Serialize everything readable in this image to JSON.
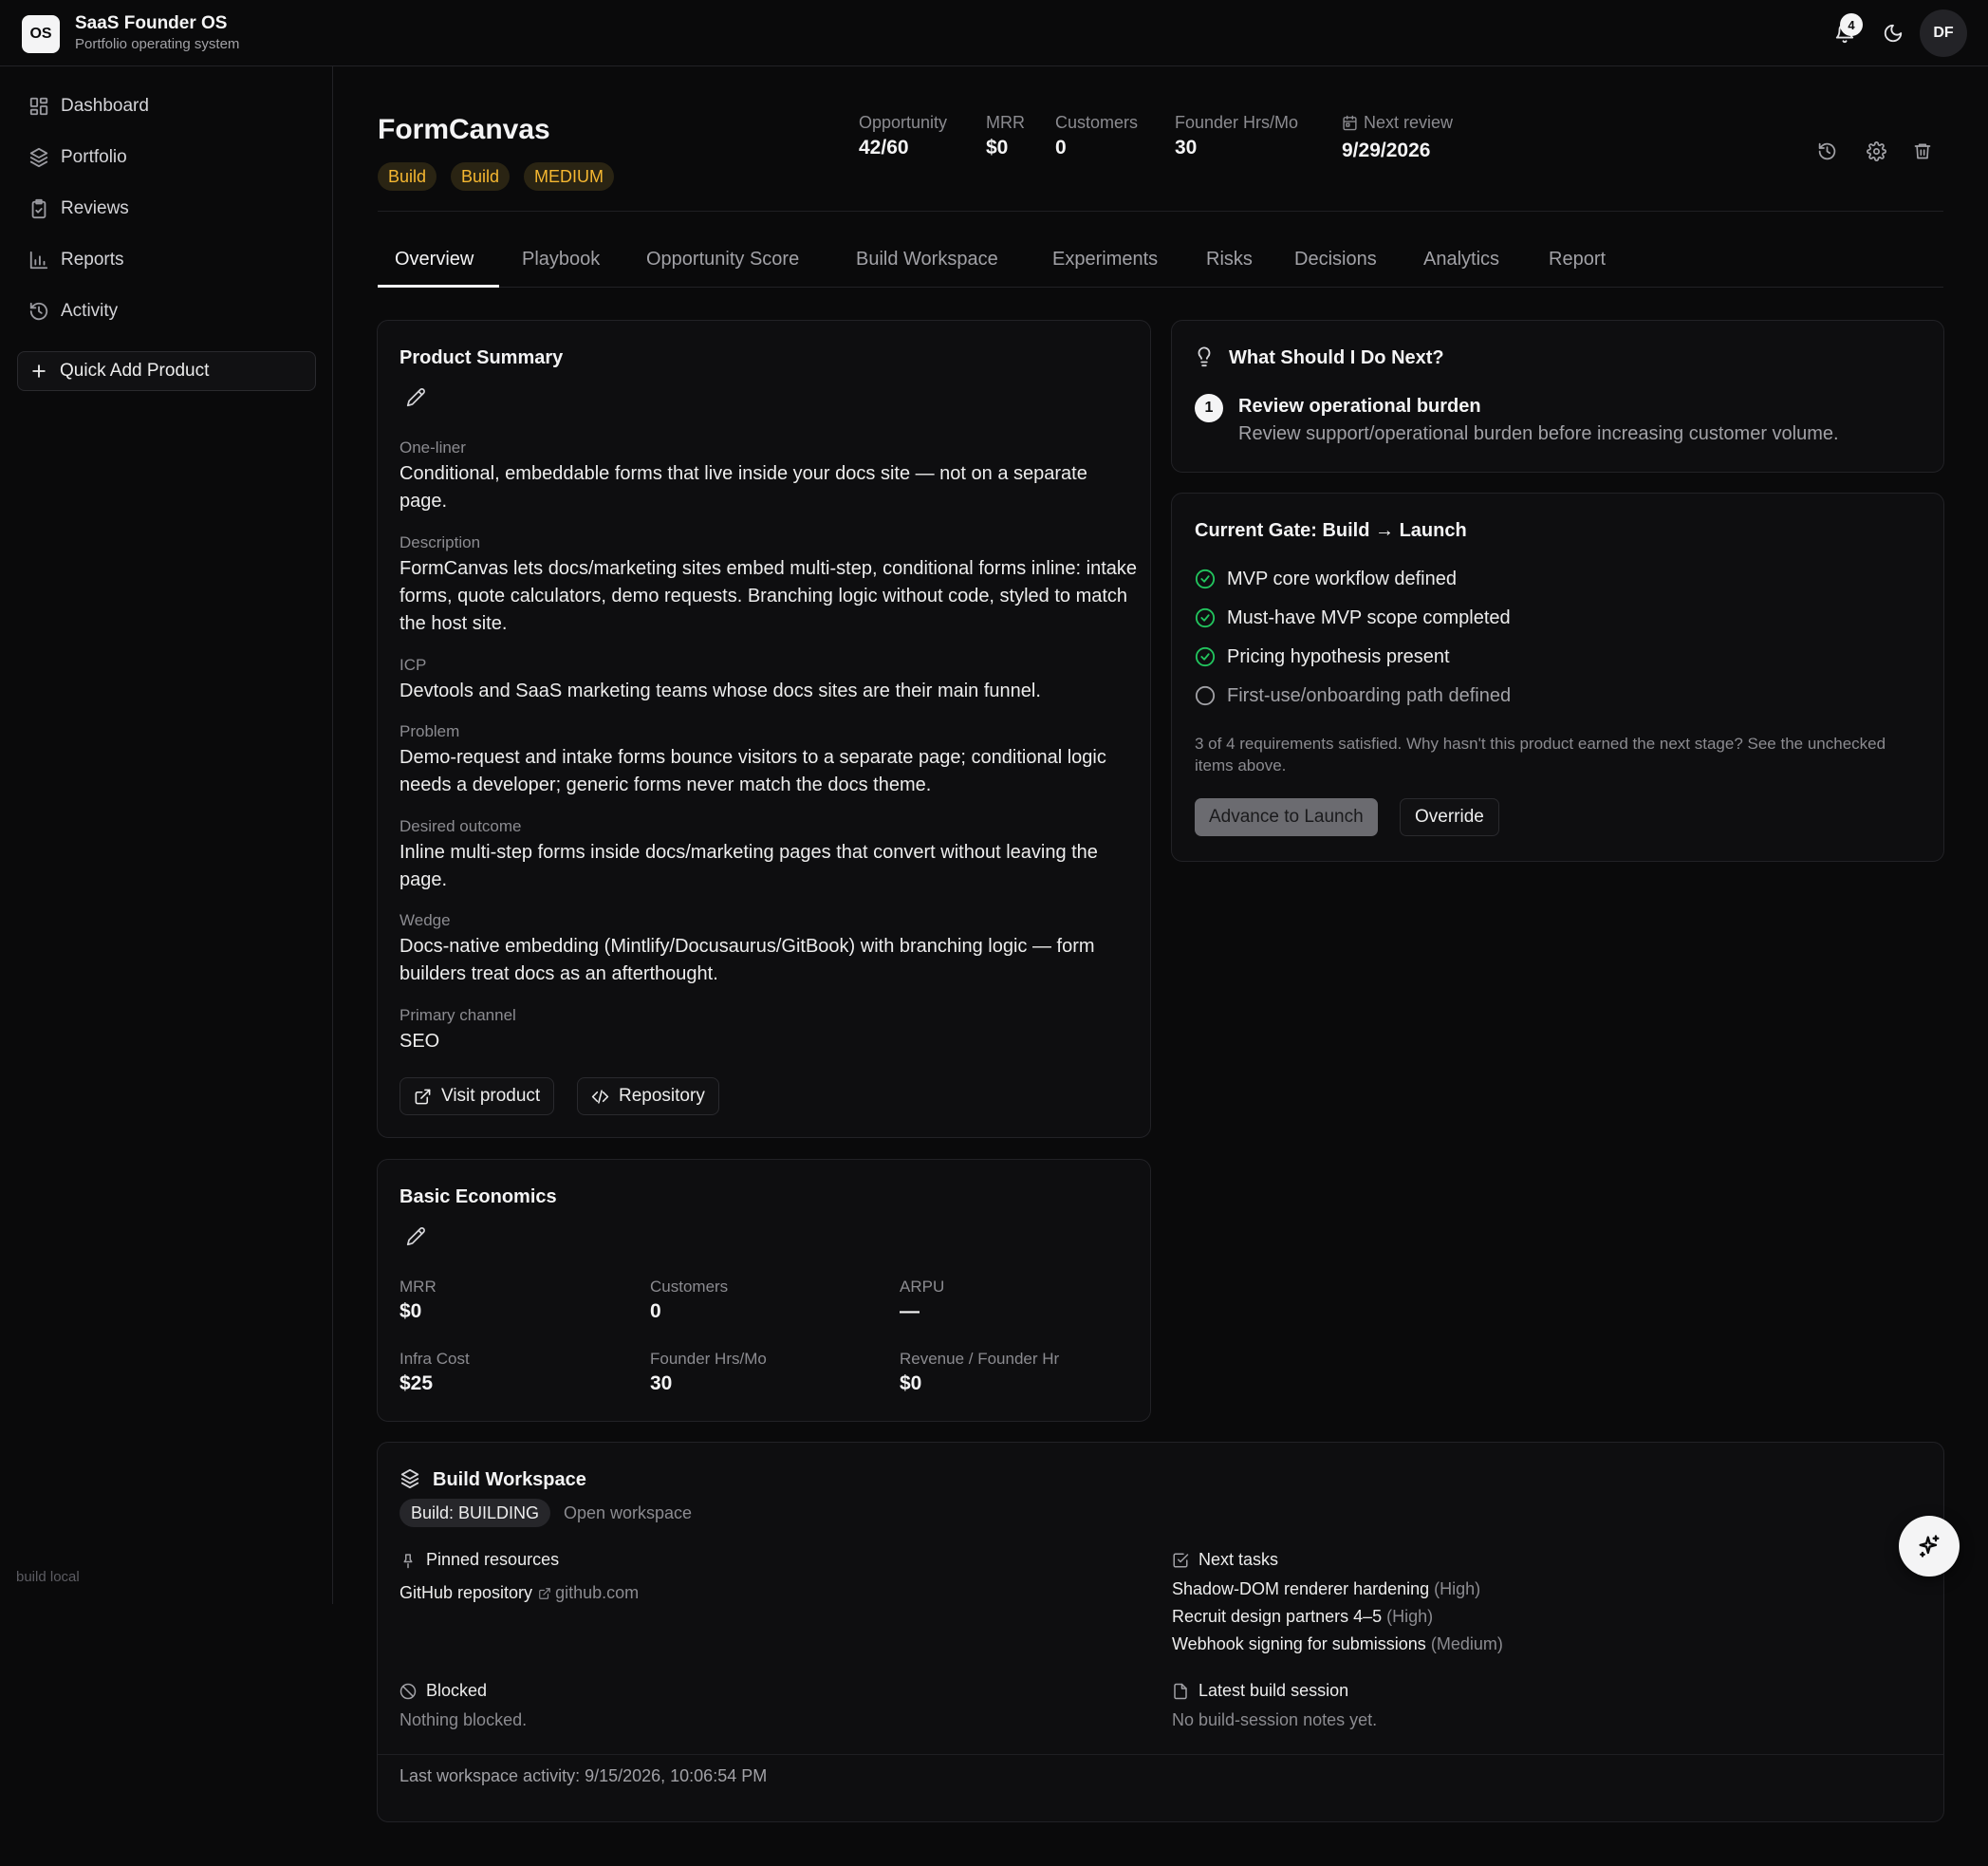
{
  "app": {
    "logo": "OS",
    "title": "SaaS Founder OS",
    "subtitle": "Portfolio operating system",
    "notifications_count": "4",
    "avatar_initials": "DF"
  },
  "sidebar": {
    "items": [
      {
        "label": "Dashboard",
        "icon": "grid-icon"
      },
      {
        "label": "Portfolio",
        "icon": "layers-icon"
      },
      {
        "label": "Reviews",
        "icon": "clipboard-check-icon"
      },
      {
        "label": "Reports",
        "icon": "bar-chart-icon"
      },
      {
        "label": "Activity",
        "icon": "history-icon"
      }
    ],
    "quick_add_label": "Quick Add Product",
    "footer": "build local"
  },
  "product": {
    "name": "FormCanvas",
    "badges": [
      "Build",
      "Build",
      "MEDIUM"
    ],
    "metrics": [
      {
        "label": "Opportunity",
        "value": "42/60"
      },
      {
        "label": "MRR",
        "value": "$0"
      },
      {
        "label": "Customers",
        "value": "0"
      },
      {
        "label": "Founder Hrs/Mo",
        "value": "30"
      },
      {
        "label": "Next review",
        "value": "9/29/2026"
      }
    ]
  },
  "tabs": [
    "Overview",
    "Playbook",
    "Opportunity Score",
    "Build Workspace",
    "Experiments",
    "Risks",
    "Decisions",
    "Analytics",
    "Report"
  ],
  "summary": {
    "title": "Product Summary",
    "fields": [
      {
        "label": "One-liner",
        "value": "Conditional, embeddable forms that live inside your docs site — not on a separate page."
      },
      {
        "label": "Description",
        "value": "FormCanvas lets docs/marketing sites embed multi-step, conditional forms inline: intake forms, quote calculators, demo requests. Branching logic without code, styled to match the host site."
      },
      {
        "label": "ICP",
        "value": "Devtools and SaaS marketing teams whose docs sites are their main funnel."
      },
      {
        "label": "Problem",
        "value": "Demo-request and intake forms bounce visitors to a separate page; conditional logic needs a developer; generic forms never match the docs theme."
      },
      {
        "label": "Desired outcome",
        "value": "Inline multi-step forms inside docs/marketing pages that convert without leaving the page."
      },
      {
        "label": "Wedge",
        "value": "Docs-native embedding (Mintlify/Docusaurus/GitBook) with branching logic — form builders treat docs as an afterthought."
      },
      {
        "label": "Primary channel",
        "value": "SEO"
      }
    ],
    "visit_label": "Visit product",
    "repo_label": "Repository"
  },
  "economics": {
    "title": "Basic Economics",
    "items": [
      {
        "label": "MRR",
        "value": "$0"
      },
      {
        "label": "Customers",
        "value": "0"
      },
      {
        "label": "ARPU",
        "value": "—"
      },
      {
        "label": "Infra Cost",
        "value": "$25"
      },
      {
        "label": "Founder Hrs/Mo",
        "value": "30"
      },
      {
        "label": "Revenue / Founder Hr",
        "value": "$0"
      }
    ]
  },
  "next": {
    "title": "What Should I Do Next?",
    "step_number": "1",
    "step_title": "Review operational burden",
    "step_desc": "Review support/operational burden before increasing customer volume."
  },
  "gate": {
    "title": "Current Gate: Build → Launch",
    "items": [
      {
        "label": "MVP core workflow defined",
        "done": true
      },
      {
        "label": "Must-have MVP scope completed",
        "done": true
      },
      {
        "label": "Pricing hypothesis present",
        "done": true
      },
      {
        "label": "First-use/onboarding path defined",
        "done": false
      }
    ],
    "note": "3 of 4 requirements satisfied. Why hasn't this product earned the next stage? See the unchecked items above.",
    "advance_label": "Advance to Launch",
    "override_label": "Override"
  },
  "workspace": {
    "title": "Build Workspace",
    "badge": "Build: BUILDING",
    "open_label": "Open workspace",
    "pinned_title": "Pinned resources",
    "pinned_name": "GitHub repository",
    "pinned_host": "github.com",
    "tasks_title": "Next tasks",
    "tasks": [
      {
        "name": "Shadow-DOM renderer hardening",
        "priority": "(High)"
      },
      {
        "name": "Recruit design partners 4–5",
        "priority": "(High)"
      },
      {
        "name": "Webhook signing for submissions",
        "priority": "(Medium)"
      }
    ],
    "blocked_title": "Blocked",
    "blocked_text": "Nothing blocked.",
    "session_title": "Latest build session",
    "session_text": "No build-session notes yet.",
    "last_activity": "Last workspace activity: 9/15/2026, 10:06:54 PM"
  },
  "colors": {
    "accent_badge_text": "#f5b731",
    "check_green": "#22c55e",
    "background": "#0a0a0b"
  }
}
